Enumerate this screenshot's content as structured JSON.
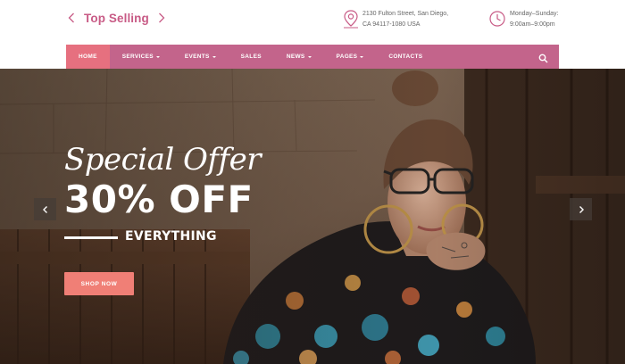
{
  "brand": {
    "name": "Top Selling"
  },
  "contact": {
    "address_line1": "2130 Fulton Street, San Diego,",
    "address_line2": "CA 94117-1080 USA",
    "hours_line1": "Monday–Sunday:",
    "hours_line2": "9:00am–9:00pm"
  },
  "nav": {
    "items": [
      {
        "label": "Home",
        "active": true,
        "dropdown": false
      },
      {
        "label": "Services",
        "active": false,
        "dropdown": true
      },
      {
        "label": "Events",
        "active": false,
        "dropdown": true
      },
      {
        "label": "Sales",
        "active": false,
        "dropdown": false
      },
      {
        "label": "News",
        "active": false,
        "dropdown": true
      },
      {
        "label": "Pages",
        "active": false,
        "dropdown": true
      },
      {
        "label": "Contacts",
        "active": false,
        "dropdown": false
      }
    ],
    "search_icon": "search-icon"
  },
  "hero": {
    "script_title": "Special Offer",
    "headline": "30% OFF",
    "subline": "EVERYTHING",
    "cta_label": "SHOP NOW"
  },
  "colors": {
    "brand_pink": "#c85b86",
    "nav_bg": "#c3648b",
    "nav_active": "#e6707f",
    "cta": "#f07f76"
  }
}
